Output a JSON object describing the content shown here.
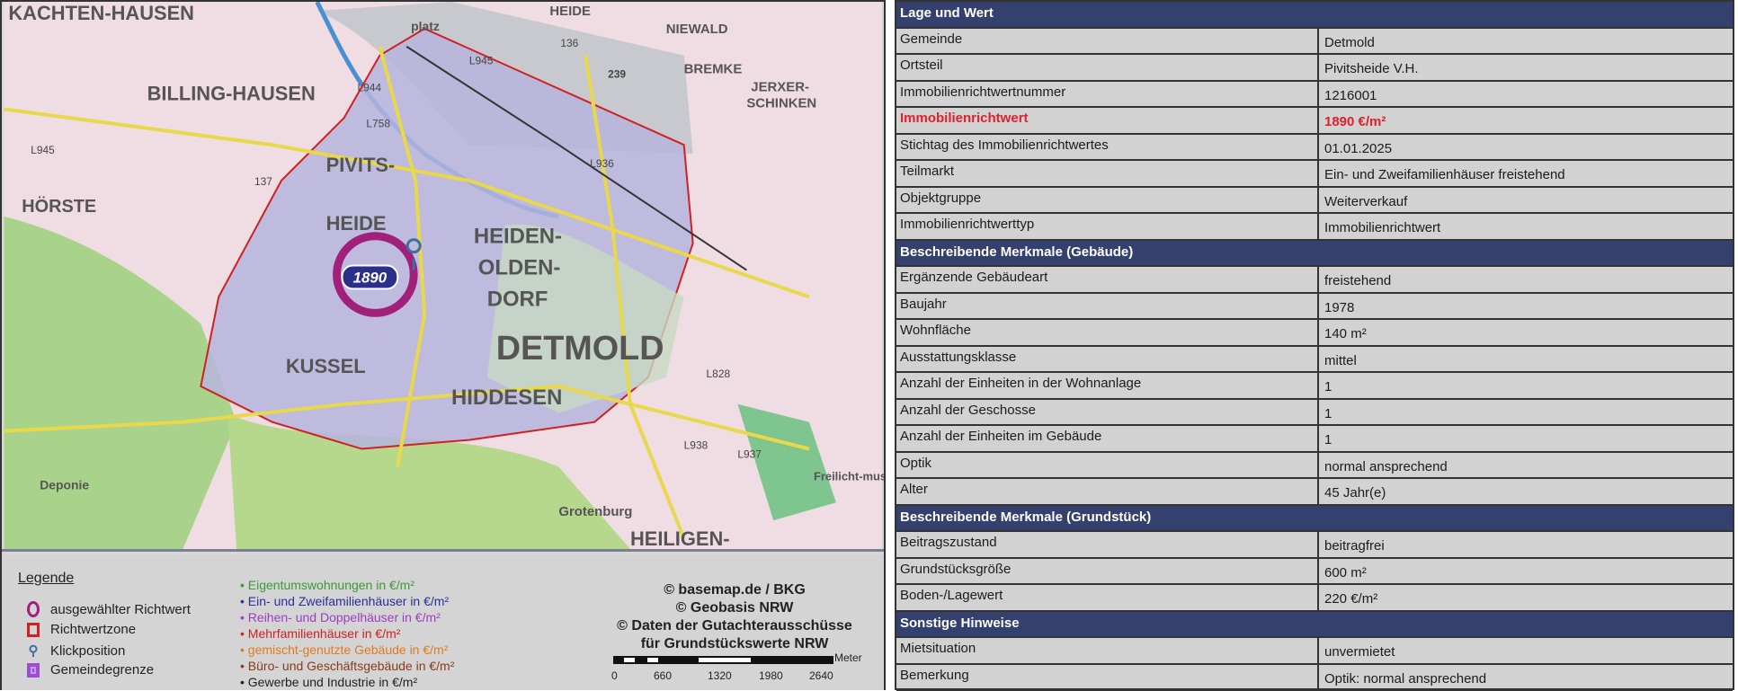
{
  "map": {
    "place_labels": [
      "KACHTEN-HAUSEN",
      "BILLING-HAUSEN",
      "HÖRSTE",
      "PIVITS-",
      "HEIDE",
      "HEIDEN-",
      "OLDEN-",
      "DORF",
      "DETMOLD",
      "KUSSEL",
      "HIDDESEN",
      "HEILIGEN-",
      "NIEWALD",
      "BREMKE",
      "JERXER-",
      "SCHINKEN",
      "HEIDE",
      "Deponie",
      "Grotenburg",
      "Freilicht-museum",
      "platz"
    ],
    "road_labels": [
      "L945",
      "L758",
      "L944",
      "L936",
      "L828",
      "L938",
      "L937",
      "239",
      "L945",
      "136",
      "137"
    ],
    "selected_value": "1890",
    "colors": {
      "zone_outline": "#d02020",
      "marker": "#a0207a",
      "value_badge": "#2a2f8a"
    }
  },
  "legend": {
    "title": "Legende",
    "symbols": [
      {
        "label": "ausgewählter Richtwert",
        "icon": "circle-icon",
        "color": "#a0207a"
      },
      {
        "label": "Richtwertzone",
        "icon": "square-icon",
        "color": "#d02020"
      },
      {
        "label": "Klickposition",
        "icon": "pin-icon",
        "color": "#3a6fa0"
      },
      {
        "label": "Gemeindegrenze",
        "icon": "boundary-icon",
        "color": "#9b4fd0"
      }
    ],
    "categories": [
      {
        "label": "• Eigentumswohnungen in €/m²",
        "color": "#3a9a3a"
      },
      {
        "label": "• Ein- und Zweifamilienhäuser in €/m²",
        "color": "#2a2f9a"
      },
      {
        "label": "• Reihen- und Doppelhäuser in €/m²",
        "color": "#9b3fc0"
      },
      {
        "label": "• Mehrfamilienhäuser in €/m²",
        "color": "#d02020"
      },
      {
        "label": "• gemischt-genutzte Gebäude in €/m²",
        "color": "#e07a20"
      },
      {
        "label": "• Büro- und Geschäftsgebäude in €/m²",
        "color": "#8a3a1a"
      },
      {
        "label": "• Gewerbe und Industrie in €/m²",
        "color": "#222222"
      }
    ],
    "credits": [
      "© basemap.de / BKG",
      "© Geobasis NRW",
      "© Daten der Gutachterausschüsse",
      "für Grundstückswerte NRW"
    ],
    "scale": {
      "unit": "Meter",
      "ticks": [
        "0",
        "660",
        "1320",
        "1980",
        "2640"
      ]
    }
  },
  "table": {
    "sections": [
      {
        "title": "Lage und Wert",
        "rows": [
          {
            "key": "Gemeinde",
            "value": "Detmold"
          },
          {
            "key": "Ortsteil",
            "value": "Pivitsheide V.H."
          },
          {
            "key": "Immobilienrichtwertnummer",
            "value": "1216001"
          },
          {
            "key": "Immobilienrichtwert",
            "value": "1890 €/m²",
            "highlight": true
          },
          {
            "key": "Stichtag des Immobilienrichtwertes",
            "value": "01.01.2025"
          },
          {
            "key": "Teilmarkt",
            "value": "Ein- und Zweifamilienhäuser freistehend"
          },
          {
            "key": "Objektgruppe",
            "value": "Weiterverkauf"
          },
          {
            "key": "Immobilienrichtwerttyp",
            "value": "Immobilienrichtwert"
          }
        ]
      },
      {
        "title": "Beschreibende Merkmale (Gebäude)",
        "rows": [
          {
            "key": "Ergänzende Gebäudeart",
            "value": "freistehend"
          },
          {
            "key": "Baujahr",
            "value": "1978"
          },
          {
            "key": "Wohnfläche",
            "value": "140 m²"
          },
          {
            "key": "Ausstattungsklasse",
            "value": "mittel"
          },
          {
            "key": "Anzahl der Einheiten in der Wohnanlage",
            "value": "1"
          },
          {
            "key": "Anzahl der Geschosse",
            "value": "1"
          },
          {
            "key": "Anzahl der Einheiten im Gebäude",
            "value": "1"
          },
          {
            "key": "Optik",
            "value": "normal ansprechend"
          },
          {
            "key": "Alter",
            "value": "45 Jahr(e)"
          }
        ]
      },
      {
        "title": "Beschreibende Merkmale (Grundstück)",
        "rows": [
          {
            "key": "Beitragszustand",
            "value": "beitragfrei"
          },
          {
            "key": "Grundstücksgröße",
            "value": "600 m²"
          },
          {
            "key": "Boden-/Lagewert",
            "value": "220 €/m²"
          }
        ]
      },
      {
        "title": "Sonstige Hinweise",
        "rows": [
          {
            "key": "Mietsituation",
            "value": "unvermietet"
          },
          {
            "key": "Bemerkung",
            "value": "Optik: normal ansprechend"
          }
        ]
      }
    ]
  }
}
